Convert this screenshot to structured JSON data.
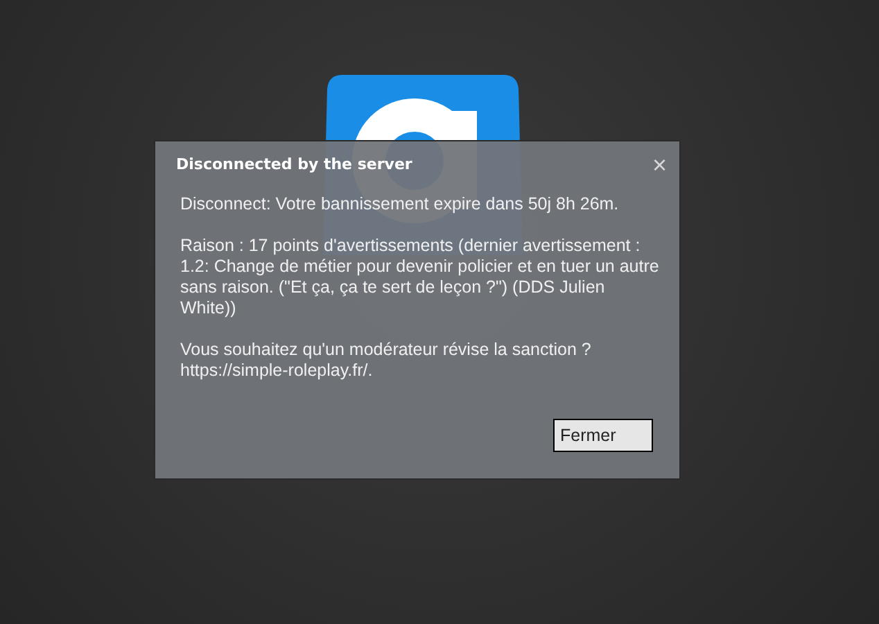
{
  "dialog": {
    "title": "Disconnected by the server",
    "close": "×",
    "paragraphs": [
      "Disconnect: Votre bannissement expire dans 50j 8h 26m.",
      "Raison : 17 points d'avertissements (dernier avertissement : 1.2: Change de métier pour devenir policier et en tuer un autre sans raison. (\"Et ça, ça te sert de leçon ?\") (DDS Julien White))",
      "Vous souhaitez qu'un modérateur révise la sanction ? https://simple-roleplay.fr/."
    ],
    "buttons": [
      "Fermer"
    ]
  }
}
